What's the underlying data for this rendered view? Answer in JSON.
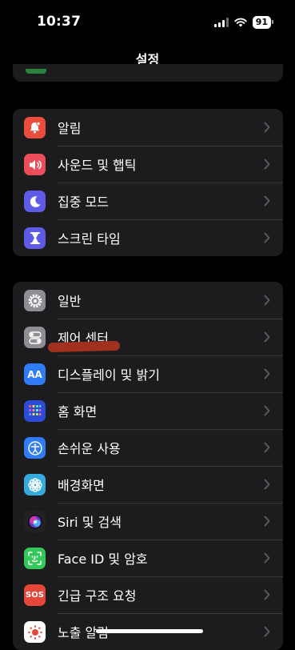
{
  "status": {
    "time": "10:37",
    "battery": "91"
  },
  "nav": {
    "title": "설정"
  },
  "groups": [
    {
      "items": [
        {
          "label": "알림",
          "color": "#eb4d3d"
        },
        {
          "label": "사운드 및 햅틱",
          "color": "#eb4d5a"
        },
        {
          "label": "집중 모드",
          "color": "#5e5ce6"
        },
        {
          "label": "스크린 타임",
          "color": "#5e5ce6"
        }
      ]
    },
    {
      "items": [
        {
          "label": "일반",
          "color": "#8e8e93"
        },
        {
          "label": "제어 센터",
          "color": "#8e8e93"
        },
        {
          "label": "디스플레이 및 밝기",
          "color": "#2f7cf6",
          "icon_text": "AA"
        },
        {
          "label": "홈 화면",
          "color": "#2c4bd6"
        },
        {
          "label": "손쉬운 사용",
          "color": "#2f7cf6"
        },
        {
          "label": "배경화면",
          "color": "#36aadc"
        },
        {
          "label": "Siri 및 검색",
          "color": "#222222"
        },
        {
          "label": "Face ID 및 암호",
          "color": "#34c759"
        },
        {
          "label": "긴급 구조 요청",
          "color": "#e5483b",
          "icon_text": "SOS"
        },
        {
          "label": "노출 알림",
          "color": "#ffffff"
        }
      ]
    }
  ]
}
